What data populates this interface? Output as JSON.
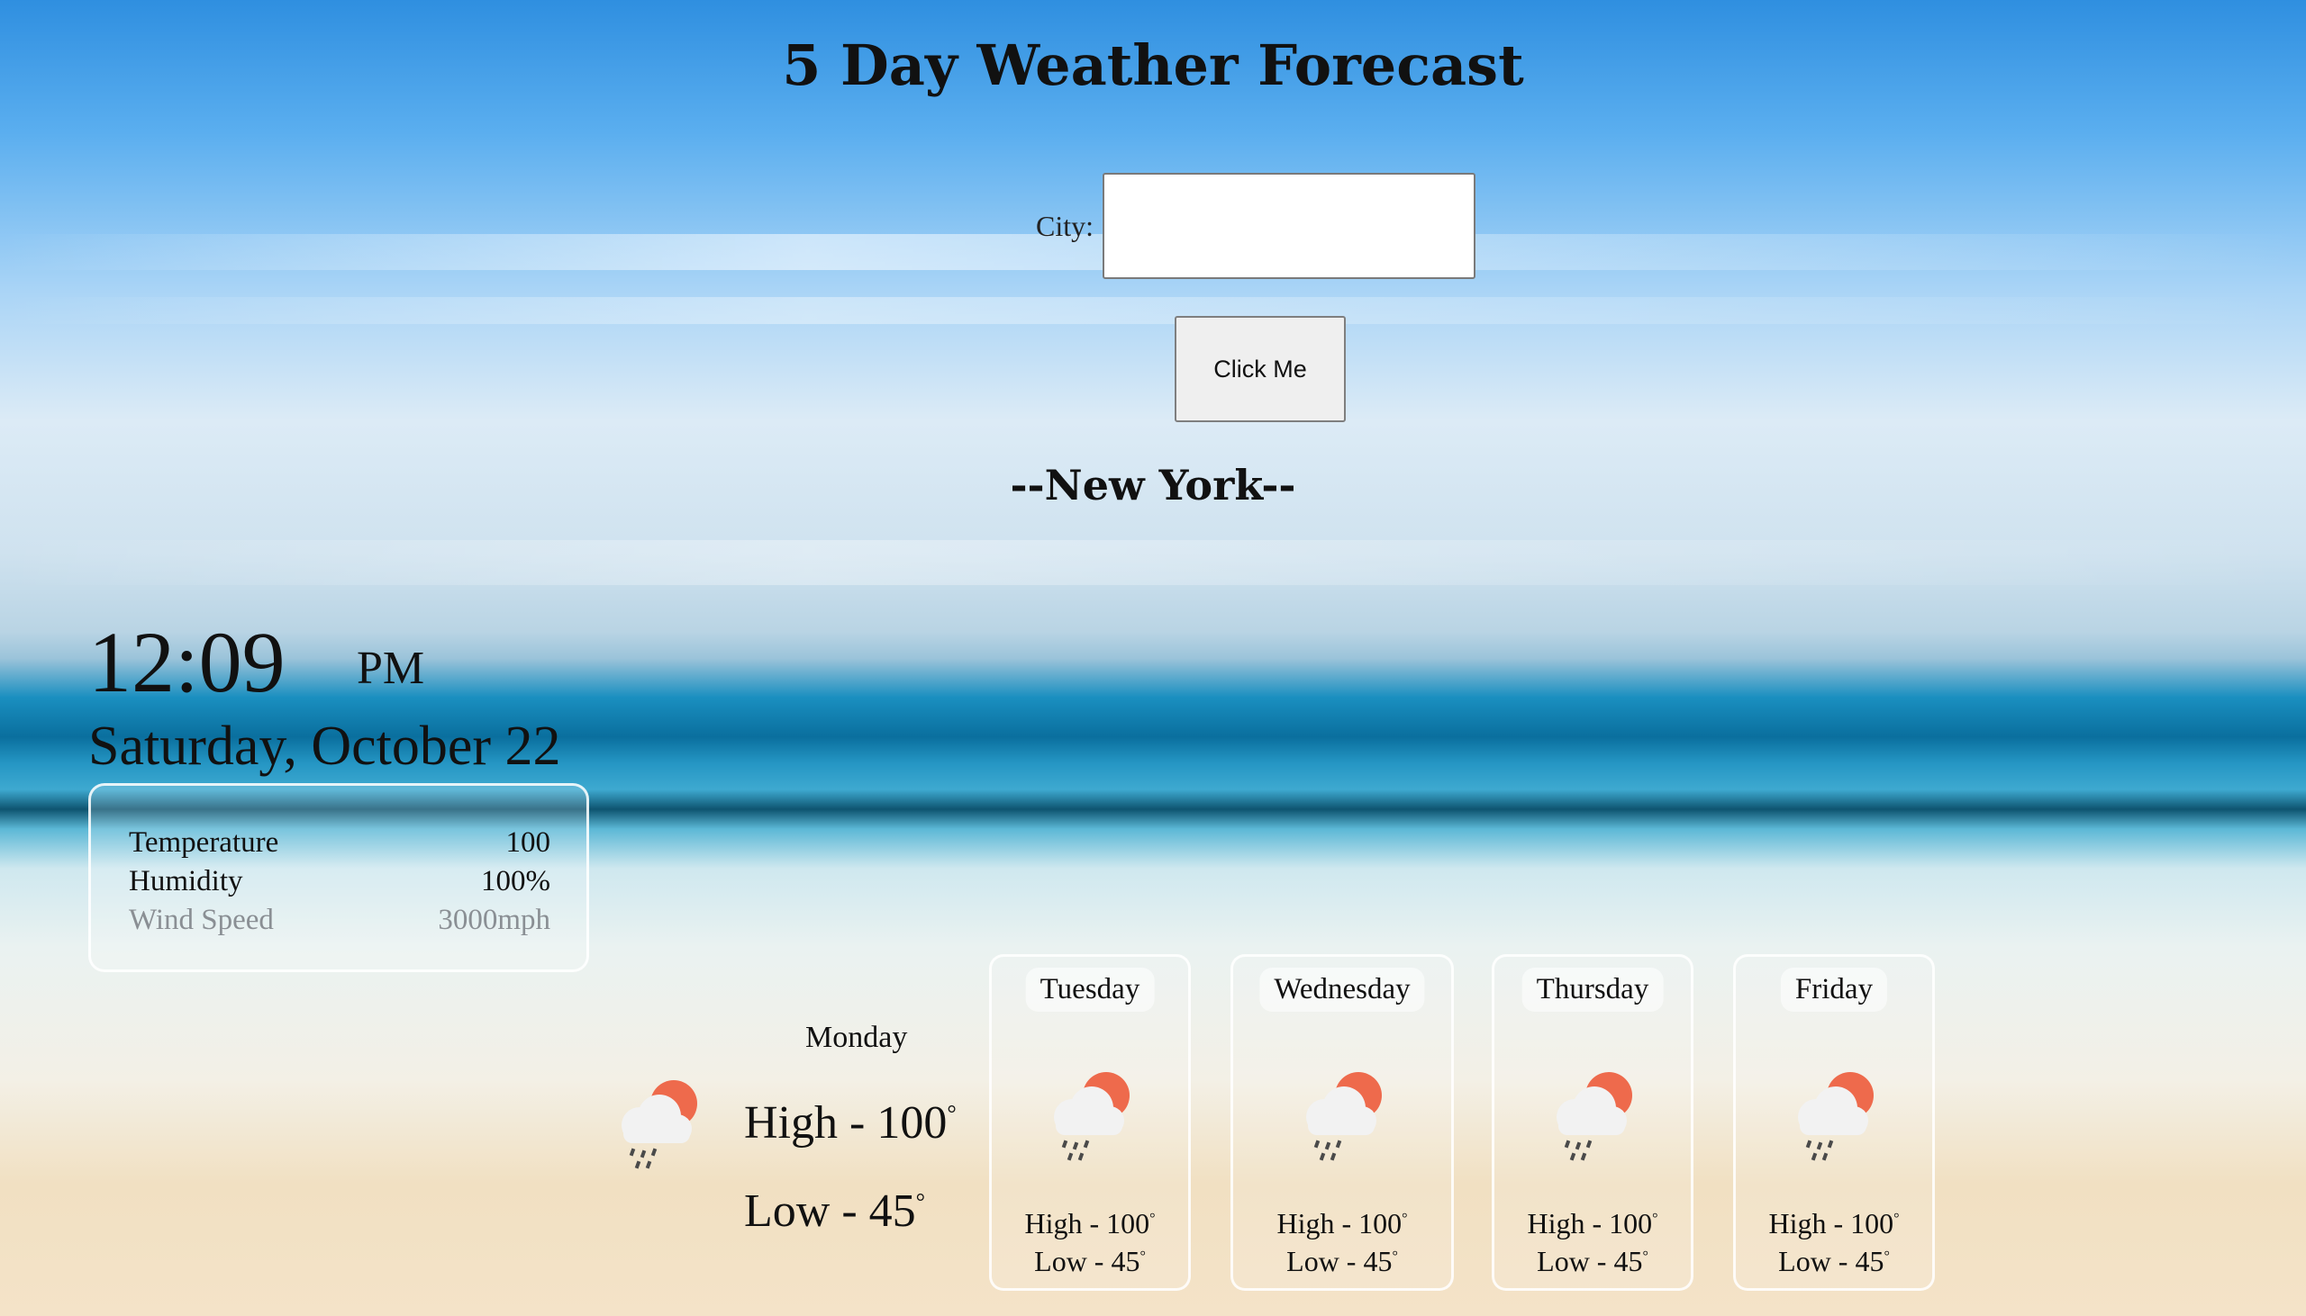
{
  "header": {
    "title": "5 Day Weather Forecast"
  },
  "search": {
    "city_label": "City:",
    "city_value": "",
    "button_label": "Click Me"
  },
  "location": {
    "city_display": "--New York--"
  },
  "clock": {
    "time": "12:09",
    "ampm": "PM",
    "date": "Saturday, October 22"
  },
  "current": {
    "temperature_label": "Temperature",
    "temperature_value": "100",
    "humidity_label": "Humidity",
    "humidity_value": "100%",
    "wind_label": "Wind Speed",
    "wind_value": "3000mph"
  },
  "forecast": [
    {
      "day": "Monday",
      "high": "High - 100",
      "low": "Low - 45",
      "icon": "rain-sun-cloud-icon"
    },
    {
      "day": "Tuesday",
      "high": "High - 100",
      "low": "Low - 45",
      "icon": "rain-sun-cloud-icon"
    },
    {
      "day": "Wednesday",
      "high": "High - 100",
      "low": "Low - 45",
      "icon": "rain-sun-cloud-icon"
    },
    {
      "day": "Thursday",
      "high": "High - 100",
      "low": "Low - 45",
      "icon": "rain-sun-cloud-icon"
    },
    {
      "day": "Friday",
      "high": "High - 100",
      "low": "Low - 45",
      "icon": "rain-sun-cloud-icon"
    }
  ],
  "degree_symbol": "°",
  "colors": {
    "sun": "#ee6a4c",
    "cloud": "#f2f2f2",
    "rain": "#4a4a4a"
  }
}
